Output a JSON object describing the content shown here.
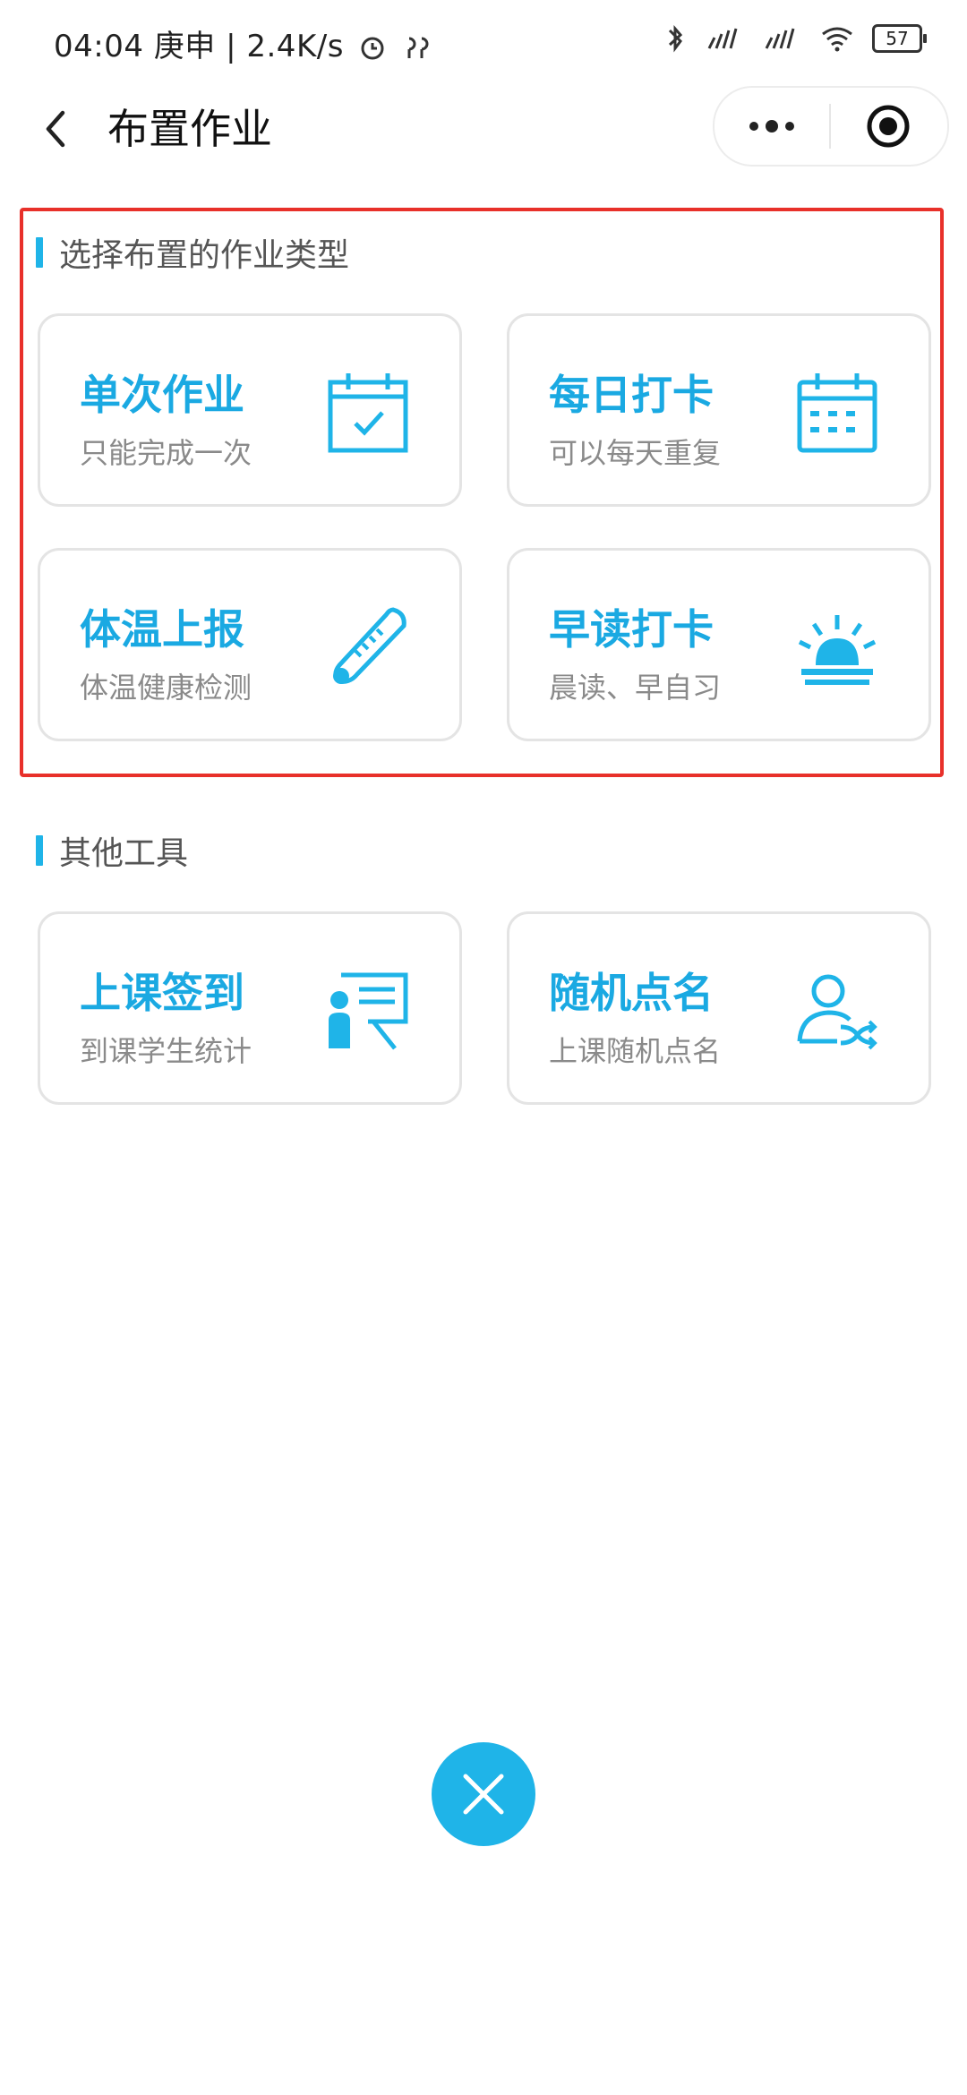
{
  "status_bar": {
    "time": "04:04",
    "extra": "庚申 | 2.4K/s",
    "battery": "57"
  },
  "nav": {
    "title": "布置作业"
  },
  "sections": {
    "homework": {
      "title": "选择布置的作业类型",
      "cards": [
        {
          "title": "单次作业",
          "subtitle": "只能完成一次",
          "icon": "calendar-check-icon"
        },
        {
          "title": "每日打卡",
          "subtitle": "可以每天重复",
          "icon": "calendar-grid-icon"
        },
        {
          "title": "体温上报",
          "subtitle": "体温健康检测",
          "icon": "thermometer-icon"
        },
        {
          "title": "早读打卡",
          "subtitle": "晨读、早自习",
          "icon": "sunrise-icon"
        }
      ]
    },
    "tools": {
      "title": "其他工具",
      "cards": [
        {
          "title": "上课签到",
          "subtitle": "到课学生统计",
          "icon": "presentation-board-icon"
        },
        {
          "title": "随机点名",
          "subtitle": "上课随机点名",
          "icon": "user-shuffle-icon"
        }
      ]
    }
  },
  "colors": {
    "accent": "#1fb4e8",
    "title_blue": "#1aa9e2",
    "highlight_border": "#e8302a"
  }
}
